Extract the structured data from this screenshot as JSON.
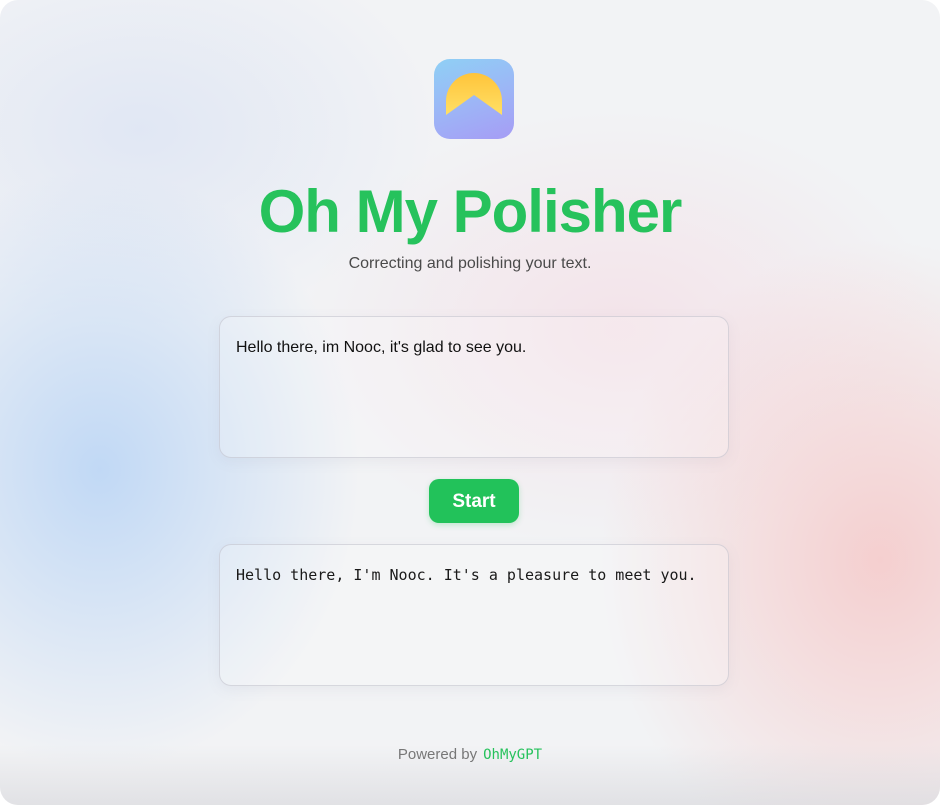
{
  "app": {
    "title": "Oh My Polisher",
    "subtitle": "Correcting and polishing your text.",
    "logo_icon": "sun-over-mountain-icon"
  },
  "input": {
    "value": "Hello there, im Nooc, it's glad to see you."
  },
  "actions": {
    "start_label": "Start"
  },
  "output": {
    "value": "Hello there, I'm Nooc. It's a pleasure to meet you."
  },
  "footer": {
    "powered_by": "Powered by",
    "brand": "OhMyGPT"
  },
  "colors": {
    "accent": "#22c25a",
    "title": "#26c25c",
    "logo_sun": "#ffd54f"
  }
}
